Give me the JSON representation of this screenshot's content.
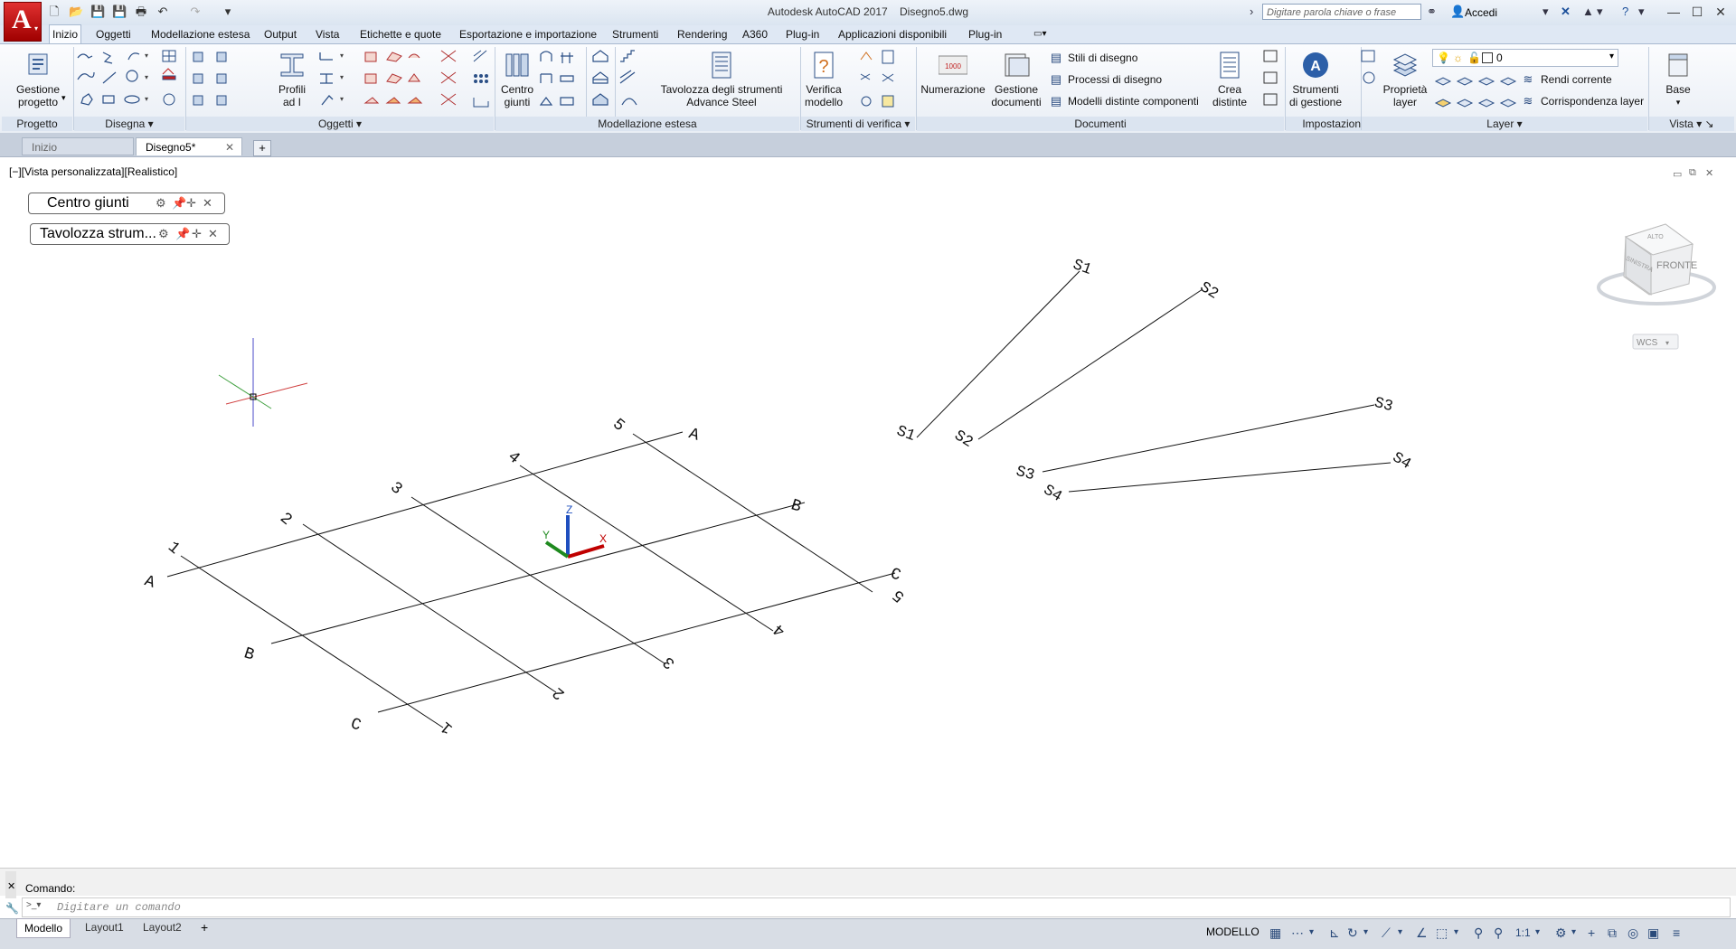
{
  "titlebar": {
    "app_name": "Autodesk AutoCAD 2017",
    "document": "Disegno5.dwg",
    "search_placeholder": "Digitare parola chiave o frase",
    "signin": "Accedi",
    "app_letter": "A"
  },
  "ribbon_tabs": [
    "Inizio",
    "Oggetti",
    "Modellazione estesa",
    "Output",
    "Vista",
    "Etichette e quote",
    "Esportazione e importazione",
    "Strumenti",
    "Rendering",
    "A360",
    "Plug-in",
    "Applicazioni disponibili",
    "Plug-in"
  ],
  "active_tab": "Inizio",
  "ribbon": {
    "project_manager": [
      "Gestione",
      "progetto"
    ],
    "profiles": [
      "Profili",
      "ad I"
    ],
    "joint_center": [
      "Centro",
      "giunti"
    ],
    "tool_palette": [
      "Tavolozza degli strumenti",
      "Advance Steel"
    ],
    "model_check": [
      "Verifica",
      "modello"
    ],
    "numbering": "Numerazione",
    "document_manager": [
      "Gestione",
      "documenti"
    ],
    "drawing_styles": "Stili di disegno",
    "drawing_processes": "Processi di disegno",
    "bom_templates": "Modelli distinte componenti",
    "create_bom": [
      "Crea",
      "distinte"
    ],
    "management_tools": [
      "Strumenti",
      "di gestione"
    ],
    "layer_properties": [
      "Proprietà",
      "layer"
    ],
    "layer_value": "0",
    "make_current": "Rendi corrente",
    "match_layer": "Corrispondenza layer",
    "base": "Base",
    "numbering_icon_text": "1000"
  },
  "panels": {
    "progetto": "Progetto",
    "disegna": "Disegna",
    "oggetti": "Oggetti",
    "modellazione": "Modellazione estesa",
    "verifica": "Strumenti di verifica",
    "documenti": "Documenti",
    "impostazioni": "Impostazioni",
    "layer": "Layer",
    "vista": "Vista"
  },
  "doc_tabs": [
    "Inizio",
    "Disegno5*"
  ],
  "viewport": {
    "label": "[−][Vista personalizzata][Realistico]",
    "palette1": "Centro giunti",
    "palette2": "Tavolozza strum...",
    "viewcube_face": "FRONTE",
    "viewcube_top": "ALTO",
    "viewcube_side": "SINISTRA",
    "wcs": "WCS",
    "ucs_x": "X",
    "ucs_y": "Y",
    "ucs_z": "Z"
  },
  "grid_labels": {
    "rows": [
      "A",
      "B",
      "C"
    ],
    "cols": [
      "1",
      "2",
      "3",
      "4",
      "5"
    ]
  },
  "section_labels": [
    "S1",
    "S2",
    "S3",
    "S4"
  ],
  "command": {
    "history": "Comando:",
    "placeholder": "Digitare un comando"
  },
  "layout_tabs": [
    "Modello",
    "Layout1",
    "Layout2"
  ],
  "status": {
    "mode": "MODELLO",
    "scale": "1:1"
  },
  "colors": {
    "accent": "#c81a1a",
    "ribbon_bg": "#f2f5fa",
    "axis_x": "#c00000",
    "axis_y": "#1f8a1f",
    "axis_z": "#1f4fbf"
  }
}
